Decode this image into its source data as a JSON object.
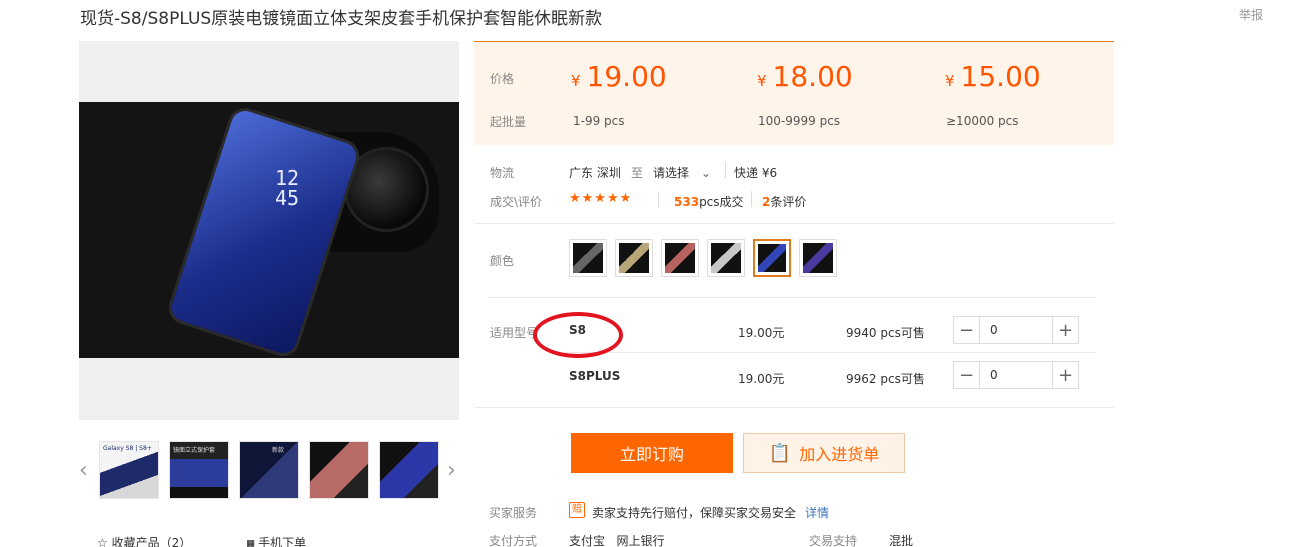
{
  "header": {
    "title": "现货-S8/S8PLUS原装电镀镜面立体支架皮套手机保护套智能休眠新款",
    "report": "举报"
  },
  "gallery": {
    "phone_time": "12\n45",
    "thumbnails": [
      {
        "name": "thumb-galaxy-s8",
        "caption": "Galaxy S8 | S8+"
      },
      {
        "name": "thumb-stand-case",
        "caption": "镜面立式保护套"
      },
      {
        "name": "thumb-new-arrival",
        "caption": "新款"
      },
      {
        "name": "thumb-rose",
        "caption": ""
      },
      {
        "name": "thumb-blue",
        "caption": ""
      }
    ],
    "favorite_label": "收藏产品（2）",
    "mobile_order_label": "手机下单"
  },
  "pricing": {
    "price_label": "价格",
    "moq_label": "起批量",
    "tiers": [
      {
        "currency": "¥",
        "price": "19.00",
        "qty": "1-99  pcs"
      },
      {
        "currency": "¥",
        "price": "18.00",
        "qty": "100-9999  pcs"
      },
      {
        "currency": "¥",
        "price": "15.00",
        "qty": "≥10000  pcs"
      }
    ]
  },
  "logistics": {
    "label": "物流",
    "origin": "广东 深圳",
    "to": "至",
    "destination": "请选择",
    "express": "快递 ¥6"
  },
  "reviews": {
    "label": "成交\\评价",
    "stars": "★★★★★",
    "sold_count": "533",
    "sold_suffix": "pcs成交",
    "review_count": "2",
    "review_suffix": "条评价"
  },
  "color": {
    "label": "颜色",
    "selected_index": 4
  },
  "models": {
    "label": "适用型号",
    "rows": [
      {
        "name": "S8",
        "price": "19.00元",
        "stock": "9940 pcs可售",
        "qty": "0"
      },
      {
        "name": "S8PLUS",
        "price": "19.00元",
        "stock": "9962 pcs可售",
        "qty": "0"
      }
    ]
  },
  "actions": {
    "buy_now": "立即订购",
    "add_to_cart": "加入进货单"
  },
  "services": {
    "seller_label": "买家服务",
    "seller_badge": "赔",
    "seller_text": "卖家支持先行赔付，保障买家交易安全",
    "details": "详情",
    "payment_label": "支付方式",
    "payment_methods": "支付宝   网上银行",
    "trade_label": "交易支持",
    "trade_value": "混批"
  },
  "colors": {
    "accent": "#ff6600",
    "price_bg": "#fff4ea",
    "annotation": "#e3141f"
  }
}
